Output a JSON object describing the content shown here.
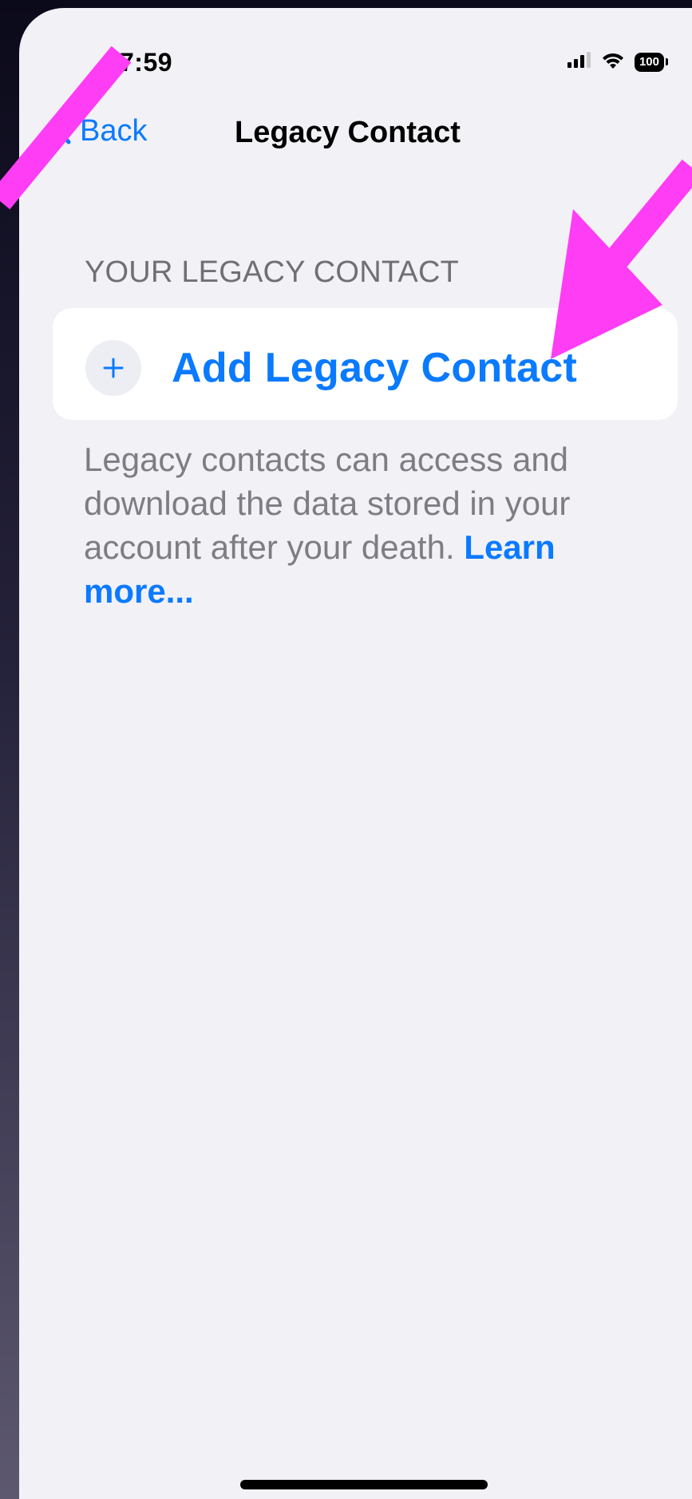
{
  "status_bar": {
    "time": "7:59",
    "battery_level": "100",
    "icons": [
      "cellular-signal-icon",
      "wifi-icon",
      "battery-icon"
    ]
  },
  "nav": {
    "back_label": "Back",
    "title": "Legacy Contact"
  },
  "section": {
    "header": "YOUR LEGACY CONTACT",
    "add_button_label": "Add Legacy Contact",
    "footer_text": "Legacy contacts can access and download the data stored in your account after your death.",
    "learn_more_label": "Learn more..."
  },
  "colors": {
    "accent": "#0a7aff",
    "background": "#f1f1f6",
    "card": "#ffffff",
    "secondary_text": "#7d7d83",
    "annotation_arrow": "#ff3df5"
  }
}
